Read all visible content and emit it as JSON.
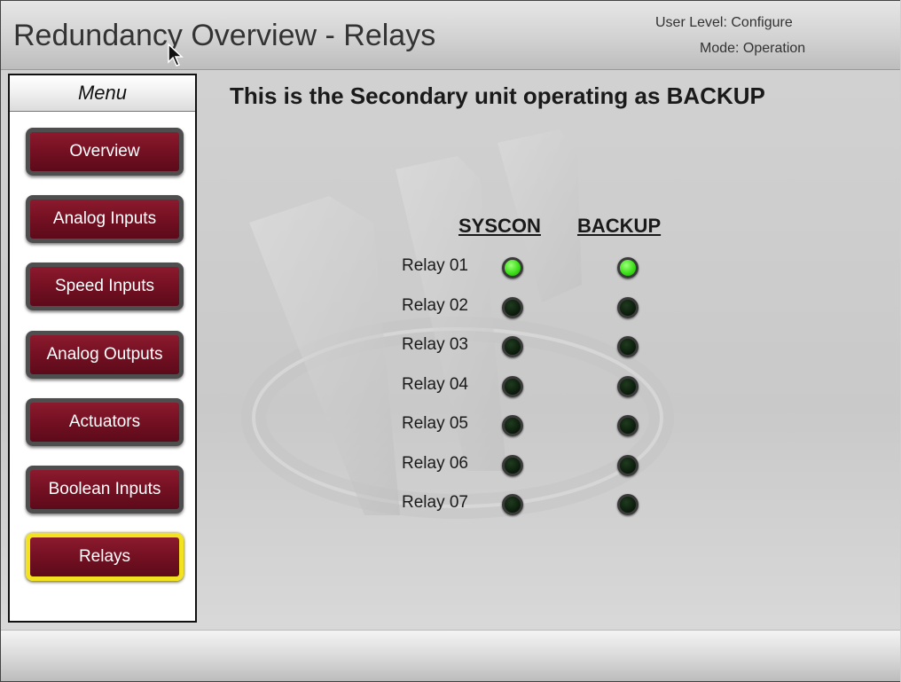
{
  "header": {
    "title": "Redundancy Overview - Relays",
    "user_level": "User Level: Configure",
    "mode": "Mode: Operation"
  },
  "menu": {
    "title": "Menu",
    "items": [
      {
        "label": "Overview",
        "active": false
      },
      {
        "label": "Analog Inputs",
        "active": false
      },
      {
        "label": "Speed Inputs",
        "active": false
      },
      {
        "label": "Analog Outputs",
        "active": false
      },
      {
        "label": "Actuators",
        "active": false
      },
      {
        "label": "Boolean Inputs",
        "active": false
      },
      {
        "label": "Relays",
        "active": true
      }
    ]
  },
  "main": {
    "message": "This is the Secondary unit operating as BACKUP",
    "columns": [
      "SYSCON",
      "BACKUP"
    ],
    "relays": [
      {
        "label": "Relay 01",
        "syscon": true,
        "backup": true
      },
      {
        "label": "Relay 02",
        "syscon": false,
        "backup": false
      },
      {
        "label": "Relay 03",
        "syscon": false,
        "backup": false
      },
      {
        "label": "Relay 04",
        "syscon": false,
        "backup": false
      },
      {
        "label": "Relay 05",
        "syscon": false,
        "backup": false
      },
      {
        "label": "Relay 06",
        "syscon": false,
        "backup": false
      },
      {
        "label": "Relay 07",
        "syscon": false,
        "backup": false
      }
    ]
  },
  "colors": {
    "button_maroon": "#761123",
    "active_border": "#f3e21f",
    "led_on": "#3ee01a",
    "led_off": "#0a1a0a"
  }
}
